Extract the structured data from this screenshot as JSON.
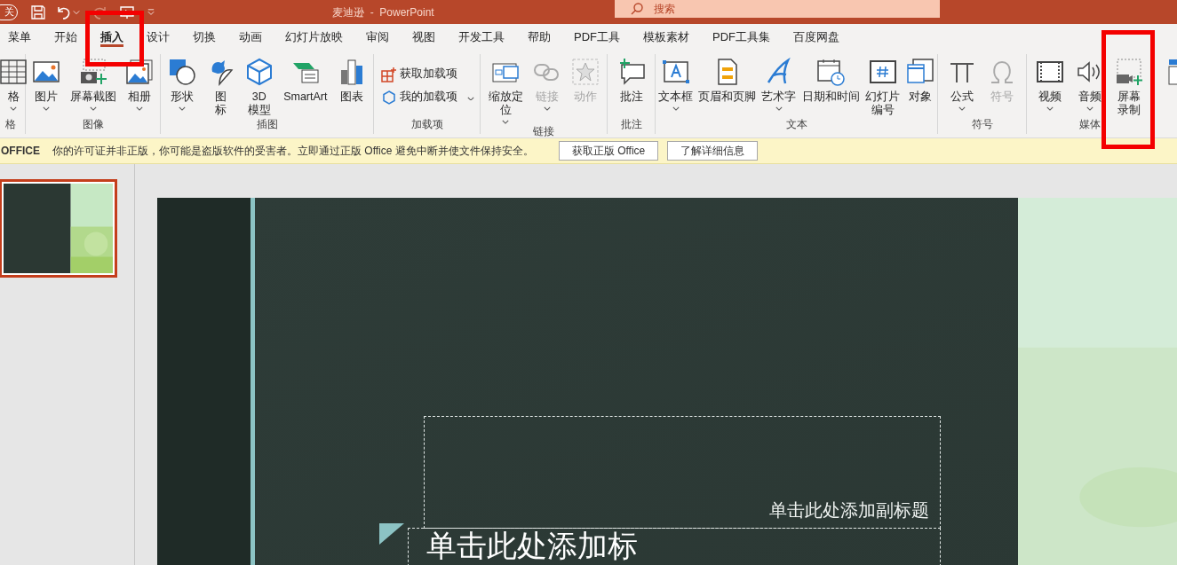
{
  "title_bar": {
    "autosave": "关",
    "title": "麦迪逊  -  PowerPoint",
    "search_placeholder": "搜索"
  },
  "tabs": [
    {
      "label": "菜单",
      "selected": false,
      "highlighted": false
    },
    {
      "label": "开始",
      "selected": false,
      "highlighted": false
    },
    {
      "label": "插入",
      "selected": true,
      "highlighted": true
    },
    {
      "label": "设计",
      "selected": false,
      "highlighted": false
    },
    {
      "label": "切换",
      "selected": false,
      "highlighted": false
    },
    {
      "label": "动画",
      "selected": false,
      "highlighted": false
    },
    {
      "label": "幻灯片放映",
      "selected": false,
      "highlighted": false
    },
    {
      "label": "审阅",
      "selected": false,
      "highlighted": false
    },
    {
      "label": "视图",
      "selected": false,
      "highlighted": false
    },
    {
      "label": "开发工具",
      "selected": false,
      "highlighted": false
    },
    {
      "label": "帮助",
      "selected": false,
      "highlighted": false
    },
    {
      "label": "PDF工具",
      "selected": false,
      "highlighted": false
    },
    {
      "label": "模板素材",
      "selected": false,
      "highlighted": false
    },
    {
      "label": "PDF工具集",
      "selected": false,
      "highlighted": false
    },
    {
      "label": "百度网盘",
      "selected": false,
      "highlighted": false
    }
  ],
  "ribbon_groups": [
    {
      "label": "格",
      "buttons": [
        {
          "kind": "large",
          "label": "格",
          "dropdown": true,
          "disabled": false,
          "highlighted": false
        }
      ]
    },
    {
      "label": "图像",
      "buttons": [
        {
          "kind": "large",
          "label": "图片",
          "dropdown": true,
          "disabled": false,
          "highlighted": false
        },
        {
          "kind": "large",
          "label": "屏幕截图",
          "dropdown": true,
          "disabled": false,
          "highlighted": false
        },
        {
          "kind": "large",
          "label": "相册",
          "dropdown": true,
          "disabled": false,
          "highlighted": false
        }
      ]
    },
    {
      "label": "插图",
      "buttons": [
        {
          "kind": "large",
          "label": "形状",
          "dropdown": true,
          "disabled": false,
          "highlighted": false
        },
        {
          "kind": "large",
          "label": "图标",
          "dropdown": false,
          "disabled": false,
          "highlighted": false
        },
        {
          "kind": "large",
          "label": "3D模型",
          "dropdown": false,
          "disabled": false,
          "highlighted": false
        },
        {
          "kind": "large",
          "label": "SmartArt",
          "dropdown": false,
          "disabled": false,
          "highlighted": false
        },
        {
          "kind": "large",
          "label": "图表",
          "dropdown": false,
          "disabled": false,
          "highlighted": false
        }
      ]
    },
    {
      "label": "加载项",
      "buttons": [
        {
          "kind": "small",
          "label": "获取加载项",
          "dropdown": false,
          "disabled": false,
          "highlighted": false
        },
        {
          "kind": "small",
          "label": "我的加载项",
          "dropdown": true,
          "disabled": false,
          "highlighted": false
        }
      ]
    },
    {
      "label": "链接",
      "buttons": [
        {
          "kind": "large",
          "label": "缩放定位",
          "dropdown": true,
          "disabled": false,
          "highlighted": false
        },
        {
          "kind": "large",
          "label": "链接",
          "dropdown": true,
          "disabled": true,
          "highlighted": false
        },
        {
          "kind": "large",
          "label": "动作",
          "dropdown": false,
          "disabled": true,
          "highlighted": false
        }
      ]
    },
    {
      "label": "批注",
      "buttons": [
        {
          "kind": "large",
          "label": "批注",
          "dropdown": false,
          "disabled": false,
          "highlighted": false
        }
      ]
    },
    {
      "label": "文本",
      "buttons": [
        {
          "kind": "large",
          "label": "文本框",
          "dropdown": true,
          "disabled": false,
          "highlighted": false
        },
        {
          "kind": "large",
          "label": "页眉和页脚",
          "dropdown": false,
          "disabled": false,
          "highlighted": false
        },
        {
          "kind": "large",
          "label": "艺术字",
          "dropdown": true,
          "disabled": false,
          "highlighted": false
        },
        {
          "kind": "large",
          "label": "日期和时间",
          "dropdown": false,
          "disabled": false,
          "highlighted": false
        },
        {
          "kind": "large",
          "label": "幻灯片编号",
          "dropdown": false,
          "disabled": false,
          "highlighted": false
        },
        {
          "kind": "large",
          "label": "对象",
          "dropdown": false,
          "disabled": false,
          "highlighted": false
        }
      ]
    },
    {
      "label": "符号",
      "buttons": [
        {
          "kind": "large",
          "label": "公式",
          "dropdown": true,
          "disabled": false,
          "highlighted": false
        },
        {
          "kind": "large",
          "label": "符号",
          "dropdown": false,
          "disabled": true,
          "highlighted": false
        }
      ]
    },
    {
      "label": "媒体",
      "buttons": [
        {
          "kind": "large",
          "label": "视频",
          "dropdown": true,
          "disabled": false,
          "highlighted": false
        },
        {
          "kind": "large",
          "label": "音频",
          "dropdown": true,
          "disabled": false,
          "highlighted": false
        },
        {
          "kind": "large",
          "label": "屏幕录制",
          "dropdown": false,
          "disabled": false,
          "highlighted": true
        }
      ]
    },
    {
      "buttons": [
        {
          "kind": "large",
          "dropdown": false
        }
      ]
    }
  ],
  "notice": {
    "brand": "OFFICE",
    "message": "你的许可证并非正版，你可能是盗版软件的受害者。立即通过正版 Office 避免中断并使文件保持安全。",
    "buttons": [
      "获取正版 Office",
      "了解详细信息"
    ]
  },
  "thumbnails": [
    {
      "selected": true
    }
  ],
  "slide": {
    "subtitle_placeholder": "单击此处添加副标题",
    "title_placeholder": "单击此处添加标"
  }
}
